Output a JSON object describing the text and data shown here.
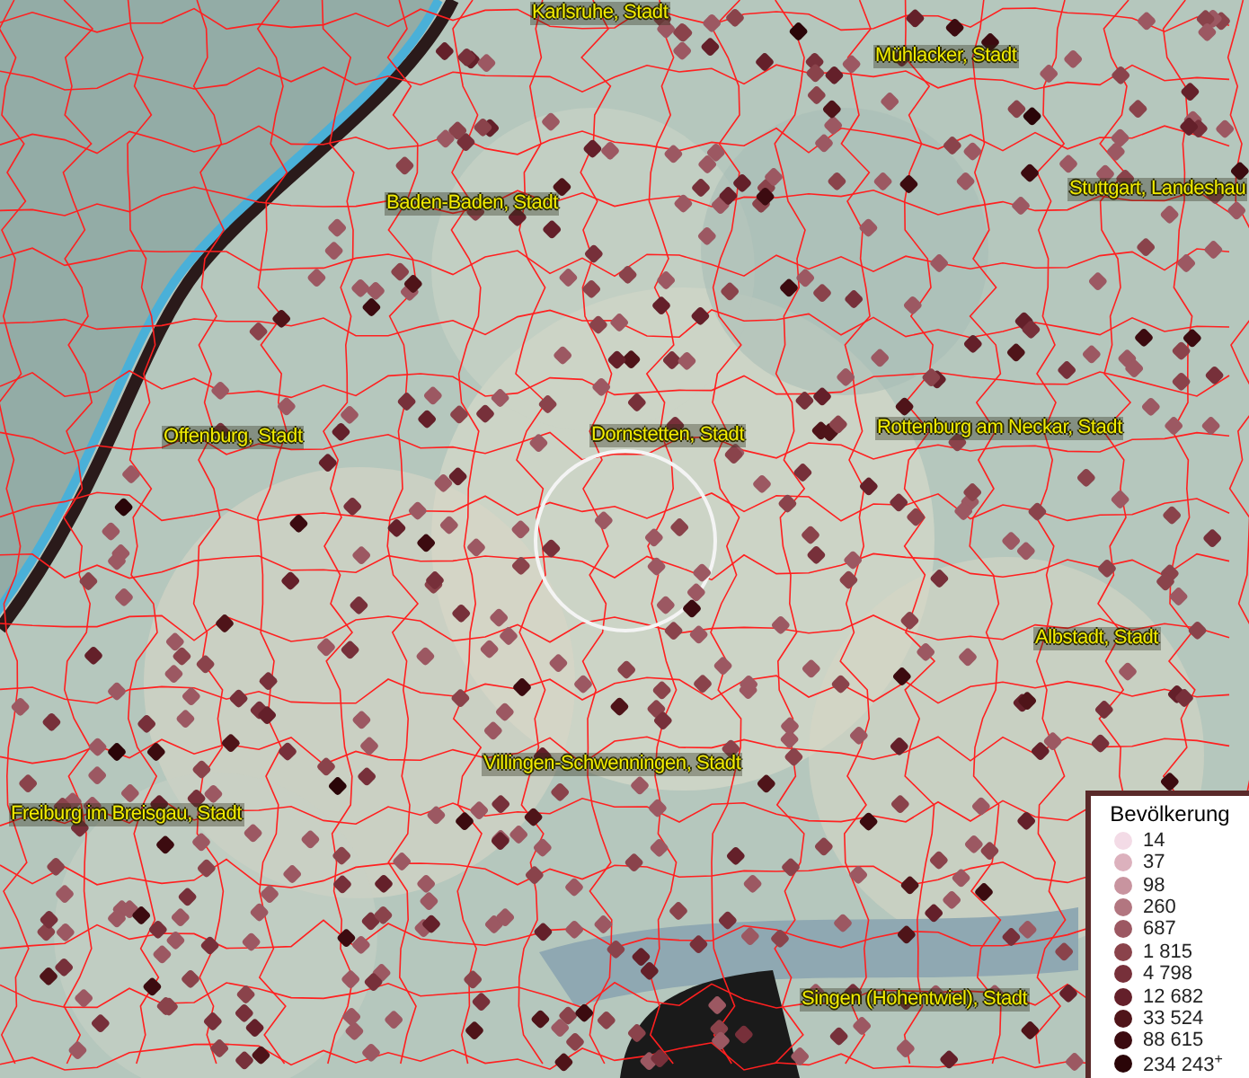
{
  "place_labels": [
    {
      "text": "Karlsruhe, Stadt"
    },
    {
      "text": "Mühlacker, Stadt"
    },
    {
      "text": "Baden-Baden, Stadt"
    },
    {
      "text": "Stuttgart, Landeshau"
    },
    {
      "text": "Offenburg, Stadt"
    },
    {
      "text": "Dornstetten, Stadt"
    },
    {
      "text": "Rottenburg am Neckar, Stadt"
    },
    {
      "text": "Albstadt, Stadt"
    },
    {
      "text": "Villingen-Schwenningen, Stadt"
    },
    {
      "text": "Freiburg im Breisgau, Stadt"
    },
    {
      "text": "Singen (Hohentwiel), Stadt"
    }
  ],
  "legend": {
    "title": "Bevölkerung",
    "classes": [
      {
        "label": "14",
        "color": "#f3dbe6"
      },
      {
        "label": "37",
        "color": "#dcb1bd"
      },
      {
        "label": "98",
        "color": "#c8949f"
      },
      {
        "label": "260",
        "color": "#b27680"
      },
      {
        "label": "687",
        "color": "#9c5862"
      },
      {
        "label": "1 815",
        "color": "#8a434b"
      },
      {
        "label": "4 798",
        "color": "#77303a"
      },
      {
        "label": "12 682",
        "color": "#64202a"
      },
      {
        "label": "33 524",
        "color": "#4f1419"
      },
      {
        "label": "88 615",
        "color": "#3c0b10"
      },
      {
        "label": "234 243$^{+}$",
        "color": "#2a0508"
      }
    ]
  }
}
